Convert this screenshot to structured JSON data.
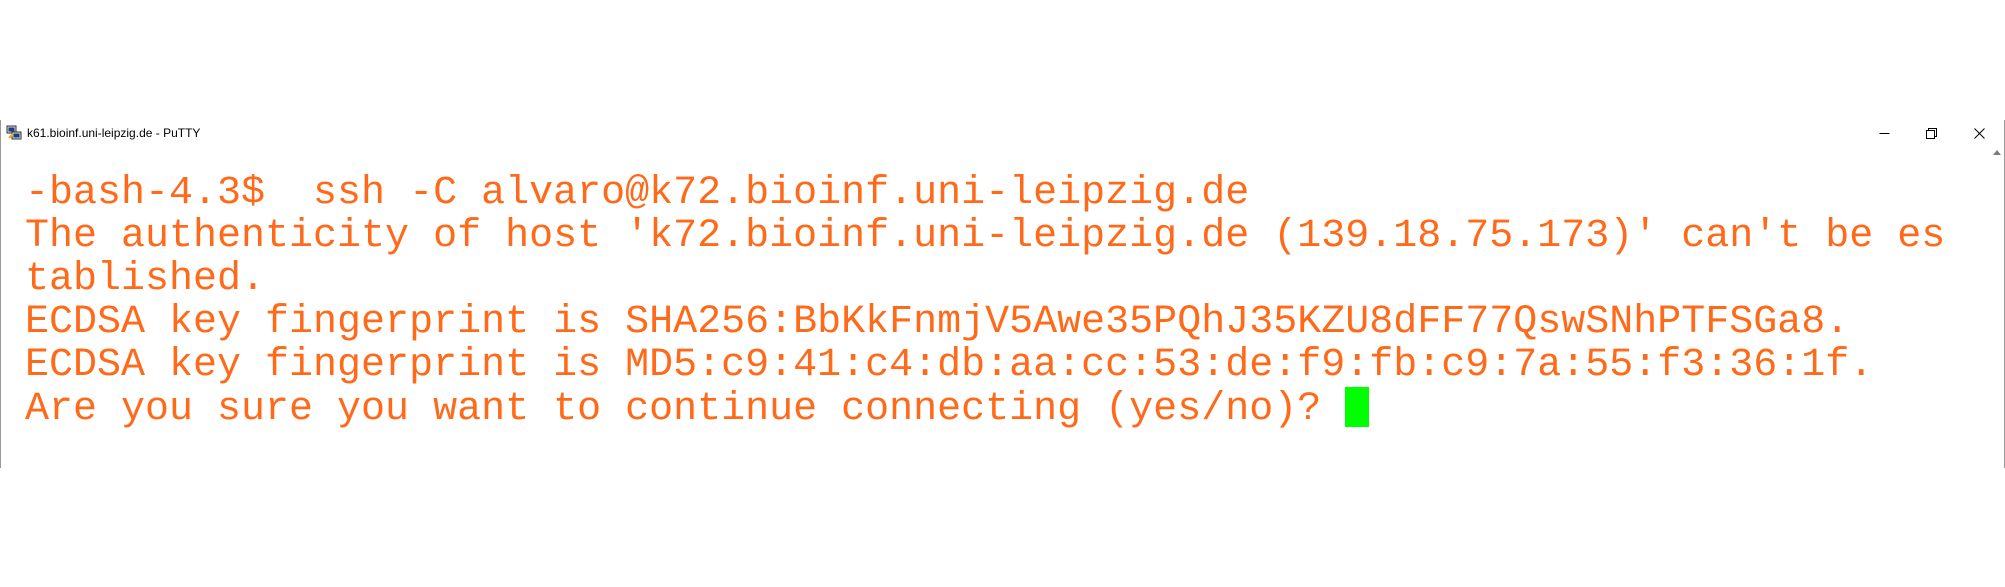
{
  "window": {
    "title": "k61.bioinf.uni-leipzig.de - PuTTY",
    "app_icon": "putty-icon",
    "controls": {
      "minimize": "minimize-icon",
      "restore": "restore-icon",
      "close": "close-icon"
    }
  },
  "terminal": {
    "text_color": "#ff6a1a",
    "background": "#ffffff",
    "cursor_color": "#00ff00",
    "lines": [
      "-bash-4.3$  ssh -C alvaro@k72.bioinf.uni-leipzig.de",
      "The authenticity of host 'k72.bioinf.uni-leipzig.de (139.18.75.173)' can't be es",
      "tablished.",
      "ECDSA key fingerprint is SHA256:BbKkFnmjV5Awe35PQhJ35KZU8dFF77QswSNhPTFSGa8.",
      "ECDSA key fingerprint is MD5:c9:41:c4:db:aa:cc:53:de:f9:fb:c9:7a:55:f3:36:1f.",
      "Are you sure you want to continue connecting (yes/no)? "
    ]
  }
}
